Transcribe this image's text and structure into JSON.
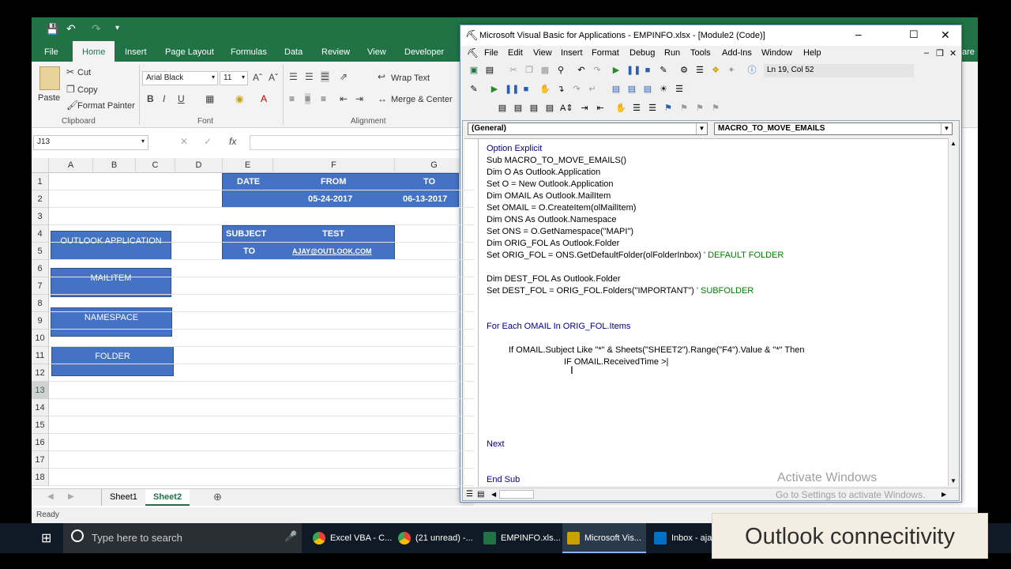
{
  "excel": {
    "tabs": [
      "File",
      "Home",
      "Insert",
      "Page Layout",
      "Formulas",
      "Data",
      "Review",
      "View",
      "Developer"
    ],
    "active_tab": "Home",
    "share_fragment": "are",
    "clipboard": {
      "paste": "Paste",
      "cut": "Cut",
      "copy": "Copy",
      "format_painter": "Format Painter",
      "label": "Clipboard"
    },
    "font": {
      "name": "Arial Black",
      "size": "11",
      "label": "Font",
      "bold": "B",
      "italic": "I",
      "underline": "U"
    },
    "alignment": {
      "wrap_text": "Wrap Text",
      "merge_center": "Merge & Center",
      "label": "Alignment"
    },
    "name_box": "J13",
    "fx": "fx",
    "columns": [
      "A",
      "B",
      "C",
      "D",
      "E",
      "F",
      "G"
    ],
    "rows": [
      "1",
      "2",
      "3",
      "4",
      "5",
      "6",
      "7",
      "8",
      "9",
      "10",
      "11",
      "12",
      "13",
      "14",
      "15",
      "16",
      "17",
      "18"
    ],
    "date_box": {
      "date": "DATE",
      "from": "FROM",
      "to": "TO",
      "from_value": "05-24-2017",
      "to_value": "06-13-2017"
    },
    "subject_box": {
      "subject": "SUBJECT",
      "subject_value": "TEST",
      "to": "TO",
      "to_value": "AJAY@OUTLOOK.COM"
    },
    "buttons": [
      "OUTLOOK APPLICATION",
      "MAILITEM",
      "NAMESPACE",
      "FOLDER"
    ],
    "sheets": [
      "Sheet1",
      "Sheet2"
    ],
    "active_sheet": "Sheet2",
    "status": "Ready",
    "accent": "#217346",
    "box_color": "#4472c4"
  },
  "vbe": {
    "title": "Microsoft Visual Basic for Applications - EMPINFO.xlsx - [Module2 (Code)]",
    "menu": [
      "File",
      "Edit",
      "View",
      "Insert",
      "Format",
      "Debug",
      "Run",
      "Tools",
      "Add-Ins",
      "Window",
      "Help"
    ],
    "position": "Ln 19, Col 52",
    "object_combo": "(General)",
    "proc_combo": "MACRO_TO_MOVE_EMAILS",
    "code": {
      "l1": "Option Explicit",
      "l2": "Sub MACRO_TO_MOVE_EMAILS()",
      "l3": "Dim O As Outlook.Application",
      "l4": "Set O = New Outlook.Application",
      "l5": "Dim OMAIL As Outlook.MailItem",
      "l6": "Set OMAIL = O.CreateItem(olMailItem)",
      "l7": "Dim ONS As Outlook.Namespace",
      "l8": "Set ONS = O.GetNamespace(\"MAPI\")",
      "l9": "Dim ORIG_FOL As Outlook.Folder",
      "l10": "Set ORIG_FOL = ONS.GetDefaultFolder(olFolderInbox)",
      "l10c": "' DEFAULT FOLDER",
      "l11": "Dim DEST_FOL As Outlook.Folder",
      "l12": "Set DEST_FOL = ORIG_FOL.Folders(\"IMPORTANT\")",
      "l12c": "' SUBFOLDER",
      "l13": "For Each OMAIL In ORIG_FOL.Items",
      "l14": "If OMAIL.Subject Like \"*\" & Sheets(\"SHEET2\").Range(\"F4\").Value & \"*\" Then",
      "l15": "IF OMAIL.ReceivedTime >|",
      "l16": "Next",
      "l17": "End Sub"
    },
    "watermark_title": "Activate Windows",
    "watermark_sub": "Go to Settings to activate Windows."
  },
  "taskbar": {
    "search_placeholder": "Type here to search",
    "apps": [
      "Excel VBA - C...",
      "(21 unread) -...",
      "EMPINFO.xls...",
      "Microsoft Vis...",
      "Inbox - aja"
    ]
  },
  "caption": "Outlook connecitivity"
}
